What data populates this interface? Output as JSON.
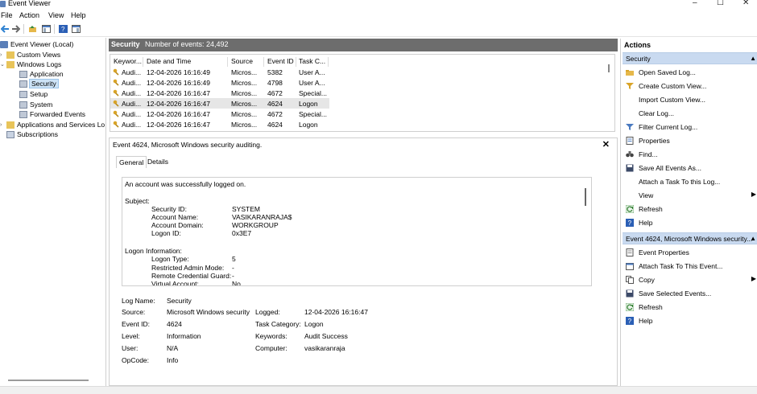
{
  "window": {
    "title": "Event Viewer",
    "controls": [
      "–",
      "☐",
      "✕"
    ]
  },
  "menu": [
    "File",
    "Action",
    "View",
    "Help"
  ],
  "toolbar": {
    "icons": [
      "back-icon",
      "forward-icon",
      "up-folder-icon",
      "show-hide-pane-icon",
      "help-icon",
      "show-hide-action-pane-icon"
    ]
  },
  "tree": {
    "root": "Event Viewer (Local)",
    "custom_views": "Custom Views",
    "windows_logs": "Windows Logs",
    "logs": [
      "Application",
      "Security",
      "Setup",
      "System",
      "Forwarded Events"
    ],
    "apps_services": "Applications and Services Lo",
    "subscriptions": "Subscriptions"
  },
  "header": {
    "log_name": "Security",
    "count_text": "Number of events: 24,492"
  },
  "events_table": {
    "columns": [
      "Keywor...",
      "Date and Time",
      "Source",
      "Event ID",
      "Task C..."
    ],
    "rows": [
      [
        "Audi...",
        "12-04-2026 16:16:49",
        "Micros...",
        "5382",
        "User A..."
      ],
      [
        "Audi...",
        "12-04-2026 16:16:49",
        "Micros...",
        "4798",
        "User A..."
      ],
      [
        "Audi...",
        "12-04-2026 16:16:47",
        "Micros...",
        "4672",
        "Special..."
      ],
      [
        "Audi...",
        "12-04-2026 16:16:47",
        "Micros...",
        "4624",
        "Logon"
      ],
      [
        "Audi...",
        "12-04-2026 16:16:47",
        "Micros...",
        "4672",
        "Special..."
      ],
      [
        "Audi...",
        "12-04-2026 16:16:47",
        "Micros...",
        "4624",
        "Logon"
      ]
    ]
  },
  "detail": {
    "title": "Event 4624, Microsoft Windows security auditing.",
    "close": "✕",
    "tabs": [
      "General",
      "Details"
    ],
    "message": {
      "line1": "An account was successfully logged on.",
      "subject": "Subject:",
      "subject_fields": [
        [
          "Security ID:",
          "SYSTEM"
        ],
        [
          "Account Name:",
          "VASIKARANRAJA$"
        ],
        [
          "Account Domain:",
          "WORKGROUP"
        ],
        [
          "Logon ID:",
          "0x3E7"
        ]
      ],
      "logon_info": "Logon Information:",
      "logon_fields": [
        [
          "Logon Type:",
          "5"
        ],
        [
          "Restricted Admin Mode:",
          "-"
        ],
        [
          "Remote Credential Guard:",
          "-"
        ],
        [
          "Virtual Account:",
          "No"
        ]
      ]
    },
    "fields": {
      "log_name_label": "Log Name:",
      "log_name": "Security",
      "source_label": "Source:",
      "source": "Microsoft Windows security",
      "logged_label": "Logged:",
      "logged": "12-04-2026 16:16:47",
      "event_id_label": "Event ID:",
      "event_id": "4624",
      "task_category_label": "Task Category:",
      "task_category": "Logon",
      "level_label": "Level:",
      "level": "Information",
      "keywords_label": "Keywords:",
      "keywords": "Audit Success",
      "user_label": "User:",
      "user": "N/A",
      "computer_label": "Computer:",
      "computer": "vasikaranraja",
      "opcode_label": "OpCode:",
      "opcode": "Info"
    }
  },
  "actions": {
    "title": "Actions",
    "section1": "Security",
    "items1": [
      {
        "label": "Open Saved Log...",
        "icon": "folder-open-icon"
      },
      {
        "label": "Create Custom View...",
        "icon": "filter-create-icon"
      },
      {
        "label": "Import Custom View...",
        "icon": ""
      },
      {
        "label": "Clear Log...",
        "icon": ""
      },
      {
        "label": "Filter Current Log...",
        "icon": "filter-icon"
      },
      {
        "label": "Properties",
        "icon": "properties-icon"
      },
      {
        "label": "Find...",
        "icon": "binoculars-icon"
      },
      {
        "label": "Save All Events As...",
        "icon": "save-icon"
      },
      {
        "label": "Attach a Task To this Log...",
        "icon": ""
      },
      {
        "label": "View",
        "icon": "",
        "submenu": "▶"
      },
      {
        "label": "Refresh",
        "icon": "refresh-icon"
      },
      {
        "label": "Help",
        "icon": "help-icon"
      }
    ],
    "section2": "Event 4624, Microsoft Windows security...",
    "items2": [
      {
        "label": "Event Properties",
        "icon": "event-properties-icon"
      },
      {
        "label": "Attach Task To This Event...",
        "icon": "task-icon"
      },
      {
        "label": "Copy",
        "icon": "copy-icon",
        "submenu": "▶"
      },
      {
        "label": "Save Selected Events...",
        "icon": "save-icon"
      },
      {
        "label": "Refresh",
        "icon": "refresh-icon"
      },
      {
        "label": "Help",
        "icon": "help-icon"
      }
    ],
    "collapse": "▲"
  },
  "colors": {
    "header_bg": "#6d6d6d",
    "section_bg": "#c9daf0",
    "selection": "#cde3f7",
    "help_blue": "#2b5fb5"
  }
}
